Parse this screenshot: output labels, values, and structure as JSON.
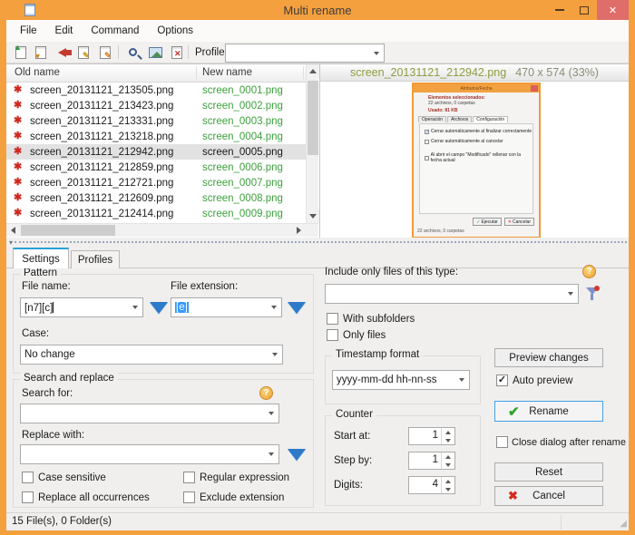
{
  "window": {
    "title": "Multi rename"
  },
  "menu": [
    "File",
    "Edit",
    "Command",
    "Options"
  ],
  "toolbar": {
    "profile_label": "Profile:",
    "profile_value": "",
    "icons": [
      "open-profile-icon",
      "save-profile-icon",
      "undo-rename-icon",
      "rename-lock-icon",
      "rename-edit-icon",
      "preview-document-icon",
      "view-image-icon",
      "error-log-icon"
    ]
  },
  "list": {
    "col_old": "Old name",
    "col_new": "New name",
    "rows": [
      {
        "old": "screen_20131121_213505.png",
        "new": "screen_0001.png",
        "selected": false
      },
      {
        "old": "screen_20131121_213423.png",
        "new": "screen_0002.png",
        "selected": false
      },
      {
        "old": "screen_20131121_213331.png",
        "new": "screen_0003.png",
        "selected": false
      },
      {
        "old": "screen_20131121_213218.png",
        "new": "screen_0004.png",
        "selected": false
      },
      {
        "old": "screen_20131121_212942.png",
        "new": "screen_0005.png",
        "selected": true
      },
      {
        "old": "screen_20131121_212859.png",
        "new": "screen_0006.png",
        "selected": false
      },
      {
        "old": "screen_20131121_212721.png",
        "new": "screen_0007.png",
        "selected": false
      },
      {
        "old": "screen_20131121_212609.png",
        "new": "screen_0008.png",
        "selected": false
      },
      {
        "old": "screen_20131121_212414.png",
        "new": "screen_0009.png",
        "selected": false
      }
    ]
  },
  "preview": {
    "filename": "screen_20131121_212942.png",
    "dimensions": "470 x 574 (33%)",
    "thumb": {
      "title": "Atributos/Fecha",
      "line1": "Elementos seleccionados:",
      "line2": "22 archivos, 0 carpetas",
      "line3": "Usado: 81 KB",
      "tabs": [
        "Operación",
        "Archivos",
        "Configuración"
      ],
      "checks": [
        "Cerrar automáticamente al finalizar correctamente",
        "Cerrar automáticamente al cancelar",
        "Al abrir el campo \"Modificado\" rellenar con la fecha actual"
      ],
      "ok": "Ejecutar",
      "cancel": "Cancelar",
      "status": "22 archivos, 0 carpetas"
    }
  },
  "tabs": {
    "settings": "Settings",
    "profiles": "Profiles"
  },
  "pattern": {
    "group": "Pattern",
    "file_name_label": "File name:",
    "file_name_value": "[n7][c]",
    "file_ext_label": "File extension:",
    "file_ext_value": "[e]",
    "case_label": "Case:",
    "case_value": "No change"
  },
  "search": {
    "group": "Search and replace",
    "search_label": "Search for:",
    "search_value": "",
    "replace_label": "Replace with:",
    "replace_value": "",
    "cb_case": "Case sensitive",
    "cb_regex": "Regular expression",
    "cb_all": "Replace all occurrences",
    "cb_exclude": "Exclude extension"
  },
  "include": {
    "label": "Include only files of this type:",
    "value": "",
    "cb_subfolders": "With subfolders",
    "cb_onlyfiles": "Only files"
  },
  "timestamp": {
    "group": "Timestamp format",
    "value": "yyyy-mm-dd hh-nn-ss"
  },
  "counter": {
    "group": "Counter",
    "start_label": "Start at:",
    "start_value": "1",
    "step_label": "Step by:",
    "step_value": "1",
    "digits_label": "Digits:",
    "digits_value": "4"
  },
  "actions": {
    "preview_changes": "Preview changes",
    "auto_preview": "Auto preview",
    "rename": "Rename",
    "close_after": "Close dialog after rename",
    "reset": "Reset",
    "cancel": "Cancel"
  },
  "status": {
    "text": "15 File(s), 0 Folder(s)"
  },
  "colors": {
    "frame": "#F4A03E",
    "close_button": "#DF6E6A",
    "new_name_green": "#3BA03B",
    "accent_blue": "#2E79C8",
    "selection": "#3399FF"
  }
}
